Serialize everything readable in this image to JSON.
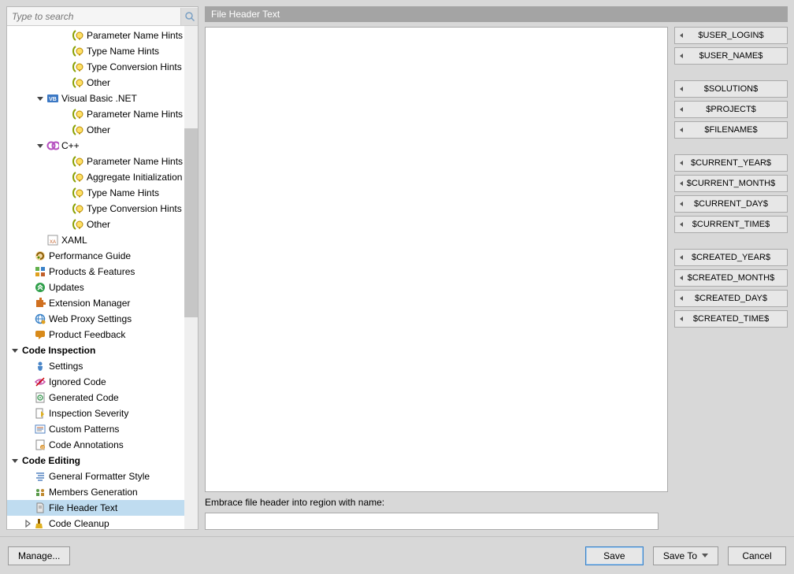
{
  "search": {
    "placeholder": "Type to search"
  },
  "title": "File Header Text",
  "region_label": "Embrace file header into region with name:",
  "tree": [
    {
      "indent": 4,
      "exp": null,
      "icon": "hint",
      "label": "Parameter Name Hints"
    },
    {
      "indent": 4,
      "exp": null,
      "icon": "hint",
      "label": "Type Name Hints"
    },
    {
      "indent": 4,
      "exp": null,
      "icon": "hint",
      "label": "Type Conversion Hints"
    },
    {
      "indent": 4,
      "exp": null,
      "icon": "hint",
      "label": "Other"
    },
    {
      "indent": 2,
      "exp": "open",
      "icon": "vb",
      "label": "Visual Basic .NET"
    },
    {
      "indent": 4,
      "exp": null,
      "icon": "hint",
      "label": "Parameter Name Hints"
    },
    {
      "indent": 4,
      "exp": null,
      "icon": "hint",
      "label": "Other"
    },
    {
      "indent": 2,
      "exp": "open",
      "icon": "cpp",
      "label": "C++"
    },
    {
      "indent": 4,
      "exp": null,
      "icon": "hint",
      "label": "Parameter Name Hints"
    },
    {
      "indent": 4,
      "exp": null,
      "icon": "hint",
      "label": "Aggregate Initialization"
    },
    {
      "indent": 4,
      "exp": null,
      "icon": "hint",
      "label": "Type Name Hints"
    },
    {
      "indent": 4,
      "exp": null,
      "icon": "hint",
      "label": "Type Conversion Hints"
    },
    {
      "indent": 4,
      "exp": null,
      "icon": "hint",
      "label": "Other"
    },
    {
      "indent": 2,
      "exp": null,
      "icon": "xaml",
      "label": "XAML"
    },
    {
      "indent": 1,
      "exp": null,
      "icon": "perf",
      "label": "Performance Guide"
    },
    {
      "indent": 1,
      "exp": null,
      "icon": "prod",
      "label": "Products & Features"
    },
    {
      "indent": 1,
      "exp": null,
      "icon": "upd",
      "label": "Updates"
    },
    {
      "indent": 1,
      "exp": null,
      "icon": "ext",
      "label": "Extension Manager"
    },
    {
      "indent": 1,
      "exp": null,
      "icon": "proxy",
      "label": "Web Proxy Settings"
    },
    {
      "indent": 1,
      "exp": null,
      "icon": "feedback",
      "label": "Product Feedback"
    },
    {
      "indent": 0,
      "exp": "open",
      "icon": null,
      "label": "Code Inspection",
      "bold": true
    },
    {
      "indent": 1,
      "exp": null,
      "icon": "settings",
      "label": "Settings"
    },
    {
      "indent": 1,
      "exp": null,
      "icon": "ignored",
      "label": "Ignored Code"
    },
    {
      "indent": 1,
      "exp": null,
      "icon": "gen",
      "label": "Generated Code"
    },
    {
      "indent": 1,
      "exp": null,
      "icon": "sev",
      "label": "Inspection Severity"
    },
    {
      "indent": 1,
      "exp": null,
      "icon": "patterns",
      "label": "Custom Patterns"
    },
    {
      "indent": 1,
      "exp": null,
      "icon": "annot",
      "label": "Code Annotations"
    },
    {
      "indent": 0,
      "exp": "open",
      "icon": null,
      "label": "Code Editing",
      "bold": true
    },
    {
      "indent": 1,
      "exp": null,
      "icon": "fmt",
      "label": "General Formatter Style"
    },
    {
      "indent": 1,
      "exp": null,
      "icon": "members",
      "label": "Members Generation"
    },
    {
      "indent": 1,
      "exp": null,
      "icon": "file",
      "label": "File Header Text",
      "selected": true
    },
    {
      "indent": 1,
      "exp": "closed",
      "icon": "cleanup",
      "label": "Code Cleanup"
    }
  ],
  "vars": [
    [
      "$USER_LOGIN$",
      "$USER_NAME$"
    ],
    [
      "$SOLUTION$",
      "$PROJECT$",
      "$FILENAME$"
    ],
    [
      "$CURRENT_YEAR$",
      "$CURRENT_MONTH$",
      "$CURRENT_DAY$",
      "$CURRENT_TIME$"
    ],
    [
      "$CREATED_YEAR$",
      "$CREATED_MONTH$",
      "$CREATED_DAY$",
      "$CREATED_TIME$"
    ]
  ],
  "footer": {
    "manage": "Manage...",
    "save": "Save",
    "save_to": "Save To",
    "cancel": "Cancel"
  },
  "icons": {
    "hint-bg": "#ffe066",
    "vb": "#3b78c4",
    "cpp": "#b54fbf",
    "xaml": "#c15f2a",
    "perf": "#e0a020",
    "prod": "#62b04c",
    "upd": "#2f9f4a",
    "ext": "#d07020",
    "proxy": "#3a82c8",
    "feedback": "#d88a1a",
    "settings": "#4a86c8",
    "ignored": "#c84fa8",
    "gen": "#4aa060",
    "sev": "#e0b020",
    "patterns": "#5282c0",
    "annot": "#d88a1a",
    "fmt": "#5282c0",
    "members": "#5a9a4a",
    "file": "#e6e6e6",
    "cleanup": "#e0b020"
  }
}
